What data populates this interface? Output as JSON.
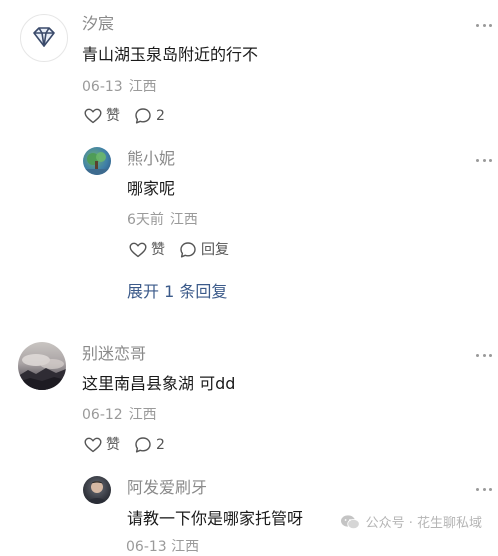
{
  "comments": [
    {
      "author": "汐宸",
      "avatar_icon": "diamond-icon",
      "text": "青山湖玉泉岛附近的行不",
      "date": "06-13",
      "location": "江西",
      "like_label": "赞",
      "reply_count": "2",
      "reply": {
        "author": "熊小妮",
        "text": "哪家呢",
        "date": "6天前",
        "location": "江西",
        "like_label": "赞",
        "reply_label": "回复"
      },
      "expand_label": "展开 1 条回复"
    },
    {
      "author": "别迷恋哥",
      "avatar_icon": "landscape-avatar",
      "text": "这里南昌县象湖 可dd",
      "date": "06-12",
      "location": "江西",
      "like_label": "赞",
      "reply_count": "2",
      "reply": {
        "author": "阿发爱刷牙",
        "text": "请教一下你是哪家托管呀",
        "date_partial": "06-13 江西"
      }
    }
  ],
  "watermark": {
    "icon": "wechat-icon",
    "text": "公众号 · 花生聊私域"
  },
  "colors": {
    "name": "#8a8a8a",
    "meta": "#9a9a9a",
    "link": "#3b5a8a",
    "text": "#1a1a1a"
  }
}
